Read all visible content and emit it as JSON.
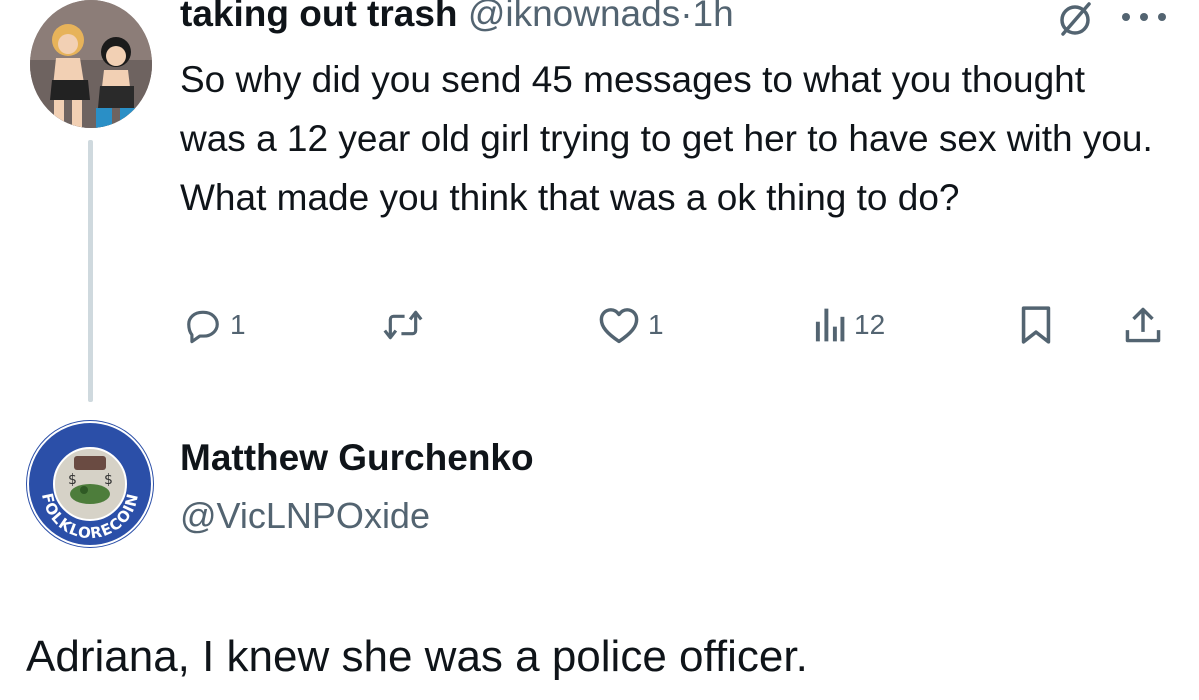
{
  "tweet1": {
    "author_name": "taking out trash",
    "author_handle": "@iknownads",
    "separator": "·",
    "time_ago": "1h",
    "text": "So why did you send 45 messages to what you thought was a 12 year old girl trying to get her to have sex with you. What made you think that was a ok thing to do?",
    "actions": {
      "reply_count": "1",
      "like_count": "1",
      "views_count": "12"
    }
  },
  "tweet2": {
    "author_name": "Matthew Gurchenko",
    "author_handle": "@VicLNPOxide",
    "avatar_text": "FOLKLORECOIN",
    "text": "Adriana, I knew she was a police officer."
  },
  "colors": {
    "text_primary": "#0f1419",
    "text_secondary": "#536471",
    "thread_line": "#cfd9de",
    "badge_blue": "#2b4fa8"
  },
  "icons": [
    "grok-icon",
    "more-icon",
    "reply-icon",
    "retweet-icon",
    "like-icon",
    "views-icon",
    "bookmark-icon",
    "share-icon"
  ]
}
